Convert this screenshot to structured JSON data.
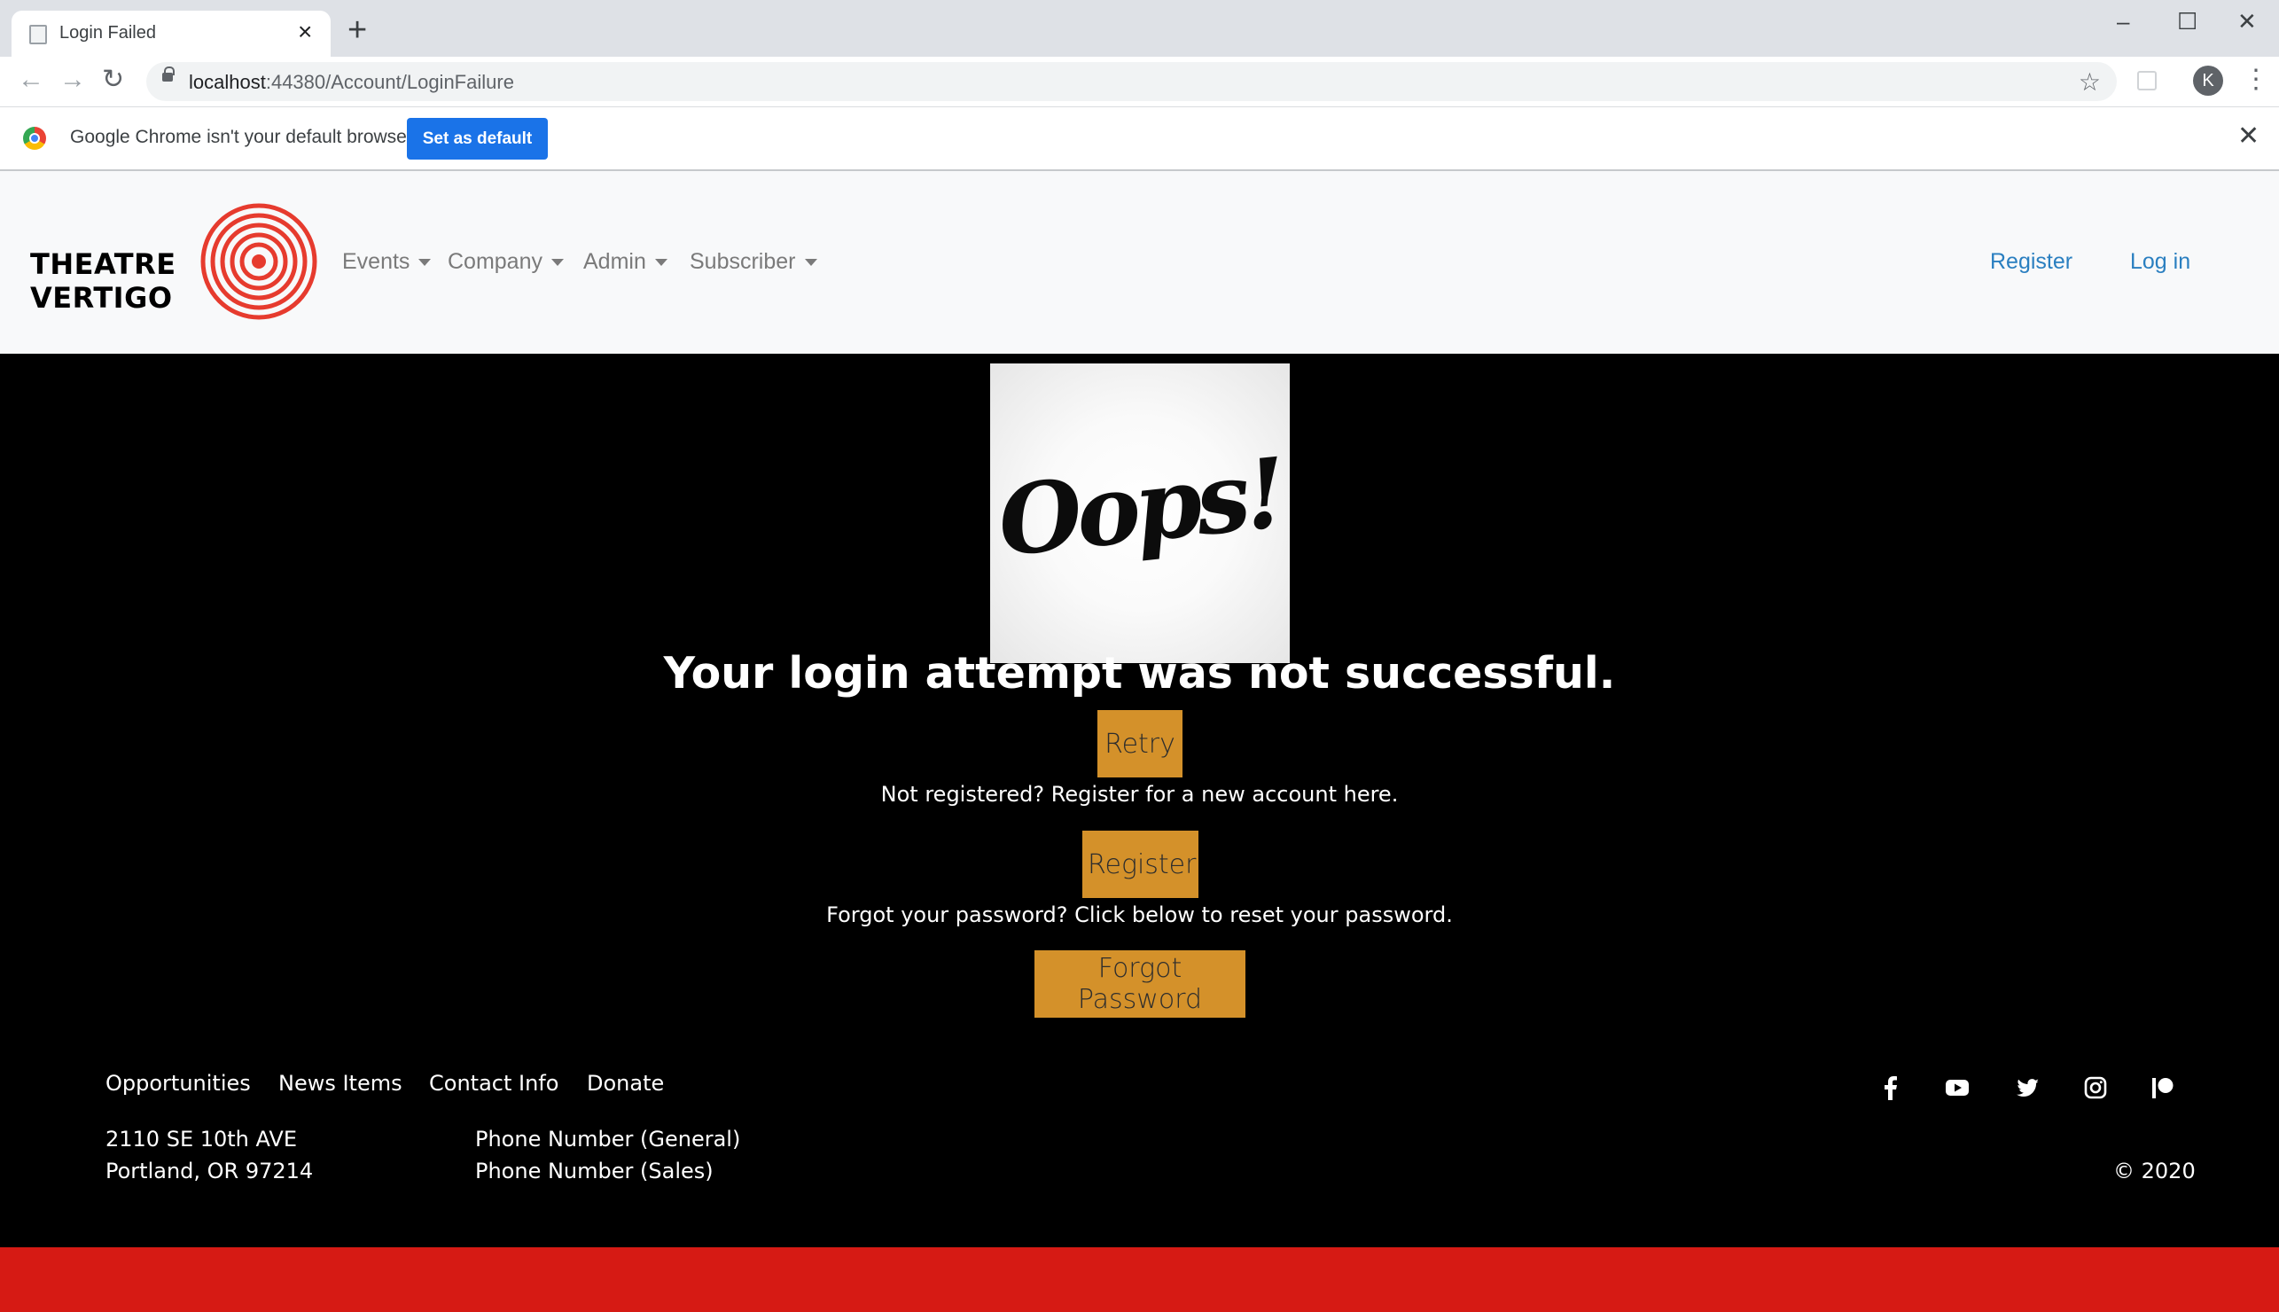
{
  "browser": {
    "tab_title": "Login Failed",
    "new_tab": "+",
    "url_host": "localhost",
    "url_rest": ":44380/Account/LoginFailure",
    "avatar_letter": "K",
    "infobar_message": "Google Chrome isn't your default browser",
    "set_default_label": "Set as default"
  },
  "navbar": {
    "logo_text": "THEATRE VERTIGO",
    "menus": [
      "Events",
      "Company",
      "Admin",
      "Subscriber"
    ],
    "register_label": "Register",
    "login_label": "Log in"
  },
  "main": {
    "oops_text": "Oops!",
    "heading": "Your login attempt was not successful.",
    "retry_label": "Retry",
    "not_registered_text": "Not registered? Register for a new account here.",
    "register_label": "Register",
    "forgot_text": "Forgot your password? Click below to reset your password.",
    "forgot_label": "Forgot Password"
  },
  "footer": {
    "links": [
      "Opportunities",
      "News Items",
      "Contact Info",
      "Donate"
    ],
    "address_line1": "2110 SE 10th AVE",
    "address_line2": "Portland, OR 97214",
    "phone_general": "Phone Number (General)",
    "phone_sales": "Phone Number (Sales)",
    "copyright": "© 2020",
    "social_icons": [
      "facebook-icon",
      "youtube-icon",
      "twitter-icon",
      "instagram-icon",
      "patreon-icon"
    ]
  },
  "colors": {
    "button_gold": "#d4912a",
    "nav_link_blue": "#2a7fc0",
    "footer_red": "#d61a14",
    "chrome_blue": "#1a73e8"
  }
}
